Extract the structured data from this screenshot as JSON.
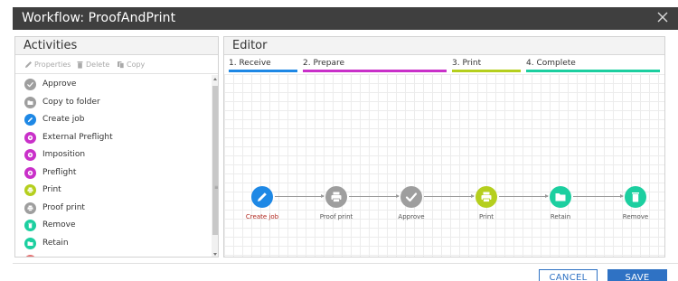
{
  "window": {
    "title": "Workflow: ProofAndPrint"
  },
  "activities": {
    "title": "Activities",
    "toolbar": {
      "properties": "Properties",
      "delete": "Delete",
      "copy": "Copy"
    },
    "items": [
      {
        "label": "Approve",
        "color": "#9e9e9e",
        "icon": "check-icon"
      },
      {
        "label": "Copy to folder",
        "color": "#9e9e9e",
        "icon": "folder-icon"
      },
      {
        "label": "Create job",
        "color": "#1e88e5",
        "icon": "pencil-icon"
      },
      {
        "label": "External Preflight",
        "color": "#c930c9",
        "icon": "gear-icon"
      },
      {
        "label": "Imposition",
        "color": "#c930c9",
        "icon": "gear-icon"
      },
      {
        "label": "Preflight",
        "color": "#c930c9",
        "icon": "gear-icon"
      },
      {
        "label": "Print",
        "color": "#b5cf1e",
        "icon": "printer-icon"
      },
      {
        "label": "Proof print",
        "color": "#9e9e9e",
        "icon": "printer-icon"
      },
      {
        "label": "Remove",
        "color": "#1ccfa0",
        "icon": "trash-icon"
      },
      {
        "label": "Retain",
        "color": "#1ccfa0",
        "icon": "folder-icon"
      }
    ]
  },
  "editor": {
    "title": "Editor",
    "stages": [
      {
        "label": "1. Receive",
        "color": "#1e88e5"
      },
      {
        "label": "2. Prepare",
        "color": "#c930c9"
      },
      {
        "label": "3. Print",
        "color": "#b5cf1e"
      },
      {
        "label": "4. Complete",
        "color": "#1ccfa0"
      }
    ],
    "nodes": [
      {
        "label": "Create job",
        "color": "#1e88e5",
        "icon": "pencil-icon",
        "selected": true
      },
      {
        "label": "Proof print",
        "color": "#9e9e9e",
        "icon": "printer-icon"
      },
      {
        "label": "Approve",
        "color": "#9e9e9e",
        "icon": "check-icon"
      },
      {
        "label": "Print",
        "color": "#b5cf1e",
        "icon": "printer-icon"
      },
      {
        "label": "Retain",
        "color": "#1ccfa0",
        "icon": "folder-icon"
      },
      {
        "label": "Remove",
        "color": "#1ccfa0",
        "icon": "trash-icon"
      }
    ]
  },
  "footer": {
    "cancel": "CANCEL",
    "save": "SAVE"
  }
}
